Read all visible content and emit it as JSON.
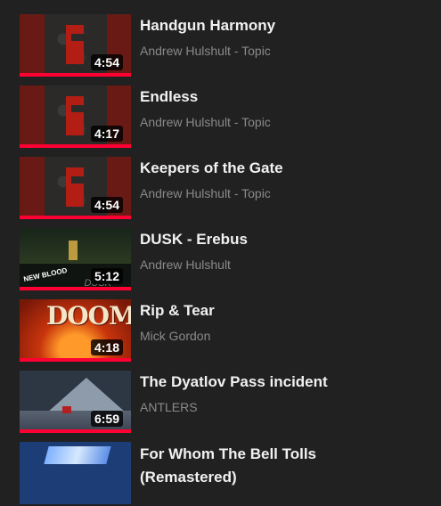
{
  "playlist": {
    "items": [
      {
        "title": "Handgun Harmony",
        "artist": "Andrew Hulshult - Topic",
        "duration": "4:54",
        "thumb_icon": "doom-e1-thumbnail",
        "watched": 1.0
      },
      {
        "title": "Endless",
        "artist": "Andrew Hulshult - Topic",
        "duration": "4:17",
        "thumb_icon": "doom-e1-thumbnail",
        "watched": 1.0
      },
      {
        "title": "Keepers of the Gate",
        "artist": "Andrew Hulshult - Topic",
        "duration": "4:54",
        "thumb_icon": "doom-e1-thumbnail",
        "watched": 1.0
      },
      {
        "title": "DUSK - Erebus",
        "artist": "Andrew Hulshult",
        "duration": "5:12",
        "thumb_icon": "dusk-thumbnail",
        "watched": 1.0,
        "thumb_text": {
          "logo": "NEW BLOOD",
          "tag": "DUSK"
        }
      },
      {
        "title": "Rip & Tear",
        "artist": "Mick Gordon",
        "duration": "4:18",
        "thumb_icon": "doom-logo-thumbnail",
        "watched": 1.0,
        "thumb_text": {
          "logo": "DOOM"
        }
      },
      {
        "title": "The Dyatlov Pass incident",
        "artist": "ANTLERS",
        "duration": "6:59",
        "thumb_icon": "snowy-mountain-thumbnail",
        "watched": 1.0
      },
      {
        "title": "For Whom The Bell Tolls (Remastered)",
        "artist": "",
        "duration": "",
        "thumb_icon": "metallica-ride-the-lightning-thumbnail",
        "watched": 0.0
      }
    ]
  },
  "colors": {
    "background": "#212121",
    "title": "#f1f1f1",
    "artist": "#8a8a8a",
    "progress": "#ff0033"
  }
}
